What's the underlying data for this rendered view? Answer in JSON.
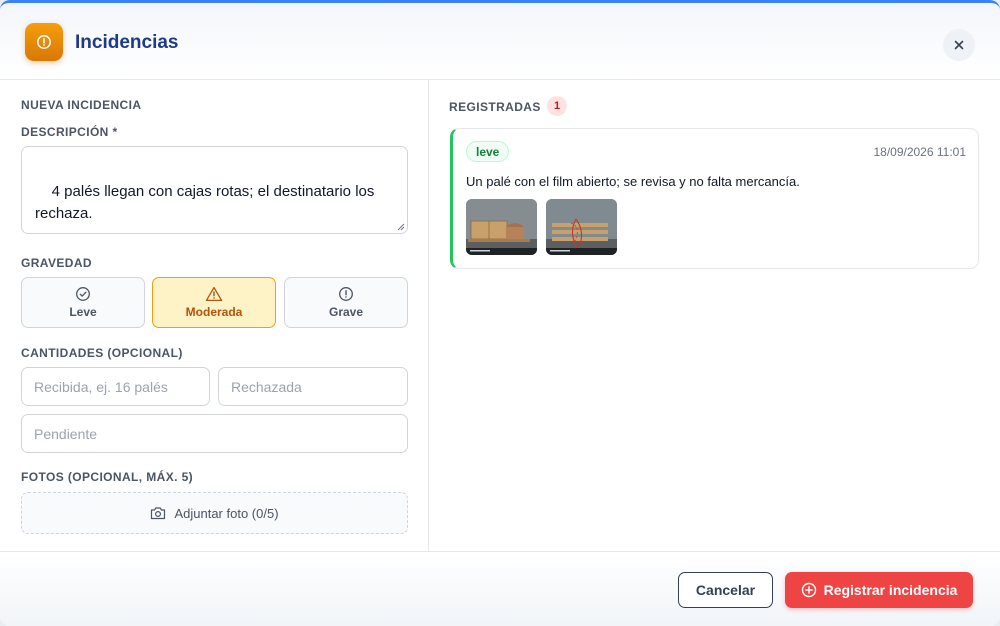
{
  "dialog": {
    "title": "Incidencias",
    "icon": "alert-circle-icon",
    "accent_color": "#d97706"
  },
  "form": {
    "section_title": "NUEVA INCIDENCIA",
    "description_label": "DESCRIPCIÓN *",
    "description_value": "4 palés llegan con cajas rotas; el destinatario los rechaza.",
    "severity_label": "GRAVEDAD",
    "severity_options": [
      {
        "label": "Leve",
        "icon": "check-circle-icon",
        "selected": false
      },
      {
        "label": "Moderada",
        "icon": "warning-triangle-icon",
        "selected": true
      },
      {
        "label": "Grave",
        "icon": "alert-circle-icon",
        "selected": false
      }
    ],
    "quantities_label": "CANTIDADES (OPCIONAL)",
    "received_placeholder": "Recibida, ej. 16 palés",
    "rejected_placeholder": "Rechazada",
    "pending_placeholder": "Pendiente",
    "photos_label": "FOTOS (OPCIONAL, MÁX. 5)",
    "attach_label": "Adjuntar foto (0/5)"
  },
  "registered": {
    "title": "REGISTRADAS",
    "count": "1",
    "items": [
      {
        "level": "leve",
        "level_color": "#15803d",
        "date": "18/09/2026 11:01",
        "description": "Un palé con el film abierto; se revisa y no falta mercancía.",
        "photos": [
          "photo-thumbnail-1",
          "photo-thumbnail-2"
        ]
      }
    ]
  },
  "footer": {
    "cancel_label": "Cancelar",
    "submit_label": "Registrar incidencia",
    "submit_color": "#ef4444"
  }
}
